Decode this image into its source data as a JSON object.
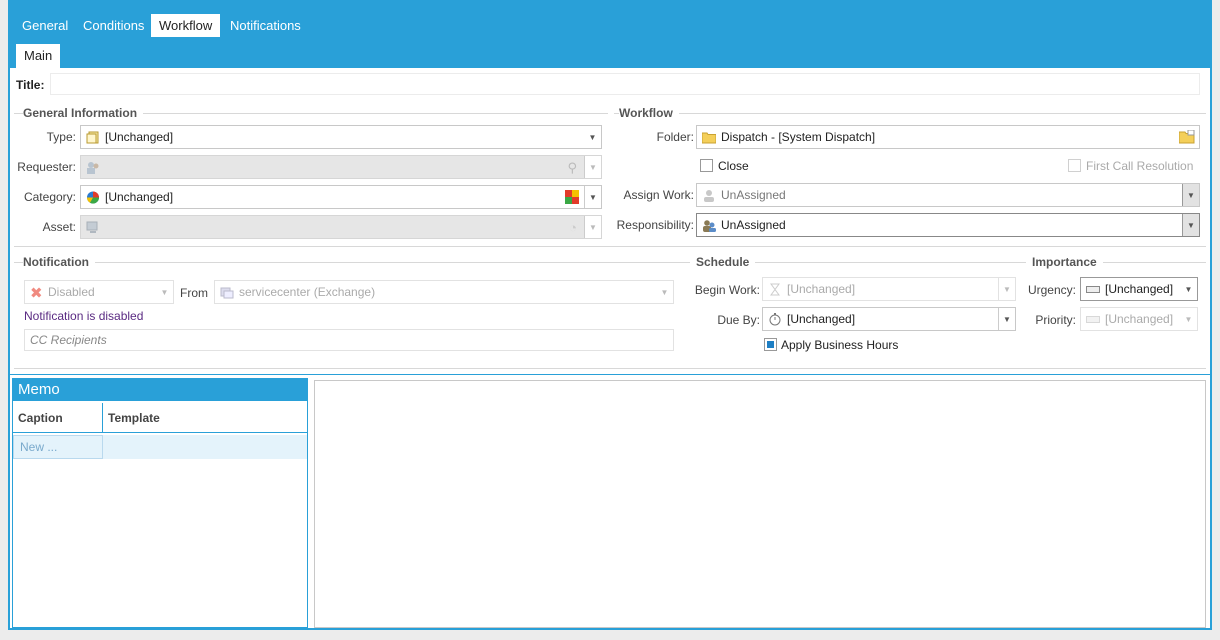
{
  "tabs": [
    "General",
    "Conditions",
    "Workflow",
    "Notifications"
  ],
  "subtab": "Main",
  "title_label": "Title:",
  "title_value": "",
  "general_info": {
    "heading": "General Information",
    "type_label": "Type:",
    "type_value": "[Unchanged]",
    "requester_label": "Requester:",
    "requester_value": "",
    "category_label": "Category:",
    "category_value": "[Unchanged]",
    "asset_label": "Asset:",
    "asset_value": ""
  },
  "workflow": {
    "heading": "Workflow",
    "folder_label": "Folder:",
    "folder_value": "Dispatch - [System Dispatch]",
    "close_label": "Close",
    "fcr_label": "First Call Resolution",
    "assign_label": "Assign Work:",
    "assign_value": "UnAssigned",
    "resp_label": "Responsibility:",
    "resp_value": "UnAssigned"
  },
  "notification": {
    "heading": "Notification",
    "status_value": "Disabled",
    "from_label": "From",
    "from_value": "servicecenter (Exchange)",
    "disabled_msg": "Notification is disabled",
    "cc_placeholder": "CC Recipients"
  },
  "schedule": {
    "heading": "Schedule",
    "begin_label": "Begin Work:",
    "begin_value": "[Unchanged]",
    "due_label": "Due By:",
    "due_value": "[Unchanged]",
    "bh_label": "Apply Business Hours"
  },
  "importance": {
    "heading": "Importance",
    "urgency_label": "Urgency:",
    "urgency_value": "[Unchanged]",
    "priority_label": "Priority:",
    "priority_value": "[Unchanged]"
  },
  "memo": {
    "title": "Memo",
    "columns": [
      "Caption",
      "Template"
    ],
    "new_row": "New ..."
  },
  "colors": {
    "accent": "#29a0d8",
    "link_purple": "#5a2a82"
  }
}
